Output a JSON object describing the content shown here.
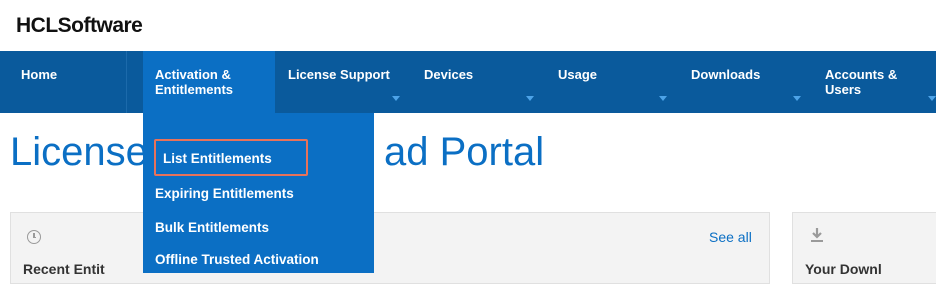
{
  "brand": {
    "logo_text": "HCLSoftware"
  },
  "nav": {
    "items": [
      {
        "label": "Home"
      },
      {
        "label": "Activation &\nEntitlements"
      },
      {
        "label": "License Support"
      },
      {
        "label": "Devices"
      },
      {
        "label": "Usage"
      },
      {
        "label": "Downloads"
      },
      {
        "label": "Accounts &\nUsers"
      }
    ]
  },
  "hero": {
    "title_left": "License",
    "title_right": "ad Portal"
  },
  "dropdown": {
    "items": [
      {
        "label": "List Entitlements",
        "highlighted": true
      },
      {
        "label": "Expiring Entitlements"
      },
      {
        "label": "Bulk Entitlements"
      },
      {
        "label": "Offline Trusted Activation"
      }
    ]
  },
  "cards": {
    "recent": {
      "see_all_label": "See all",
      "title": "Recent Entit"
    },
    "downloads": {
      "title": "Your Downl"
    }
  },
  "colors": {
    "nav_bg": "#0a5a9c",
    "active_bg": "#0b6fc4",
    "accent": "#0b6fc4",
    "highlight_border": "#e8725a"
  }
}
